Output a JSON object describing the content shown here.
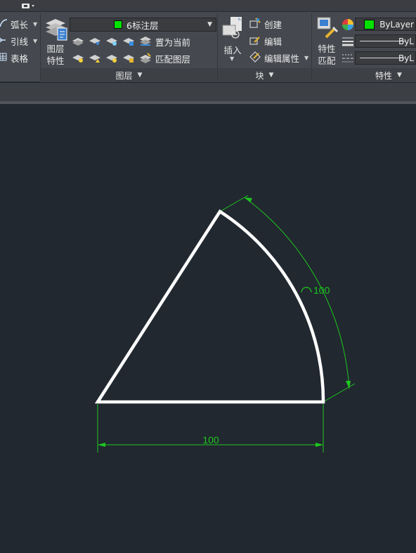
{
  "ribbon": {
    "annotation_panel": {
      "items": [
        {
          "label": "弧长",
          "icon": "arc-length-icon"
        },
        {
          "label": "引线",
          "icon": "leader-icon"
        },
        {
          "label": "表格",
          "icon": "table-icon"
        }
      ]
    },
    "layers_panel": {
      "title": "图层",
      "layer_properties_label": "图层\n特性",
      "current_layer": "6标注层",
      "current_layer_color": "#00e100",
      "buttons": [
        {
          "label": "置为当前",
          "icon": "set-current-icon"
        },
        {
          "label": "匹配图层",
          "icon": "match-layer-icon"
        }
      ]
    },
    "block_panel": {
      "title": "块",
      "insert_label": "插入",
      "buttons": [
        {
          "label": "创建",
          "icon": "create-block-icon"
        },
        {
          "label": "编辑",
          "icon": "edit-block-icon"
        },
        {
          "label": "编辑属性",
          "icon": "edit-attributes-icon"
        }
      ]
    },
    "properties_panel": {
      "title": "特性",
      "match_label": "特性\n匹配",
      "color_value": "ByLayer",
      "color_swatch": "#00e100",
      "lineweight_value": "ByL",
      "linetype_value": "ByL"
    }
  },
  "drawing": {
    "sector_stroke": "#ffffff",
    "dimension_color": "#1ec81e",
    "arc_dimension_text": "100",
    "linear_dimension_text": "100"
  }
}
